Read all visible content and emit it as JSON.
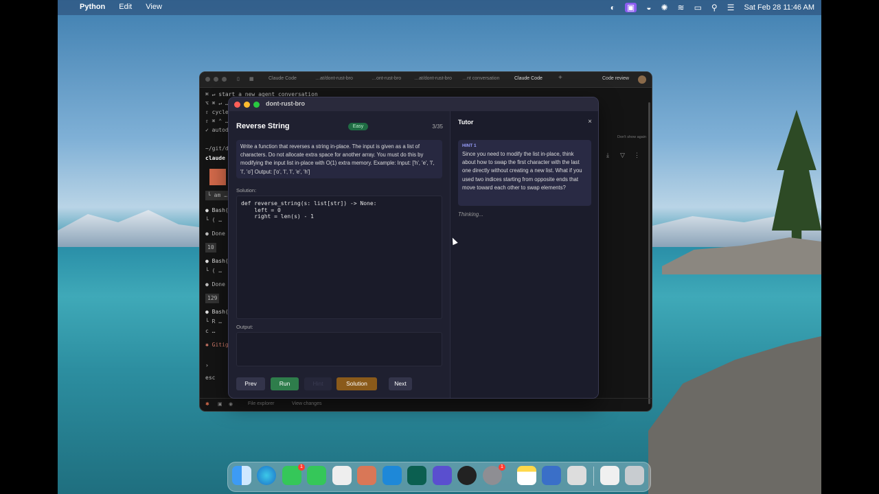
{
  "menubar": {
    "app_name": "Python",
    "items": [
      "Edit",
      "View"
    ],
    "datetime": "Sat Feb 28  11:46 AM"
  },
  "terminal": {
    "tabs": [
      "Claude Code",
      "…at/dont-rust-bro",
      "…ont-rust-bro",
      "…at/dont-rust-bro",
      "…nt conversation",
      "Claude Code"
    ],
    "code_review": "Code review",
    "lines": [
      "⌘ ↵  start a new agent conversation",
      "⌥ ⌘ ↵  …",
      "⇧  cycle p…",
      "⇧ ⌘ ⌃  …",
      "✓  autod…",
      "~/git/d…",
      "claude …",
      "└ am …",
      "● Bash(…",
      "└ ( …",
      "● Done …",
      "10",
      "● Bash(…",
      "└ ( …",
      "● Done …",
      "129",
      "● Bash(…",
      "└ R …",
      "c …",
      "✱ Gitig…",
      "›",
      "esc"
    ],
    "dont_show": "Don't show again",
    "status": {
      "file_explorer": "File explorer",
      "view_changes": "View changes"
    }
  },
  "app": {
    "window_title": "dont-rust-bro",
    "problem": {
      "title": "Reverse String",
      "difficulty": "Easy",
      "counter": "3/35",
      "description": "Write a function that reverses a string in-place. The input is given as a list of characters. Do not allocate extra space for another array. You must do this by modifying the input list in-place with O(1) extra memory. Example: Input: ['h', 'e', 'l', 'l', 'o'] Output: ['o', 'l', 'l', 'e', 'h']"
    },
    "solution_label": "Solution:",
    "code": "def reverse_string(s: list[str]) -> None:\n    left = 0\n    right = len(s) - 1",
    "output_label": "Output:",
    "buttons": {
      "prev": "Prev",
      "run": "Run",
      "hint": "Hint",
      "solution": "Solution",
      "next": "Next"
    },
    "tutor": {
      "title": "Tutor",
      "close": "×",
      "hint_label": "HINT 1",
      "hint_text": "Since you need to modify the list in-place, think about how to swap the first character with the last one directly without creating a new list. What if you used two indices starting from opposite ends that move toward each other to swap elements?",
      "thinking": "Thinking..."
    }
  },
  "dock": {
    "apps": [
      "finder-icon",
      "edge-beta-icon",
      "messages-icon",
      "phone-icon",
      "terminal-icon",
      "claude-icon",
      "vscode-icon",
      "chatgpt-icon",
      "screen-icon",
      "obs-icon",
      "settings-icon",
      "notes-icon",
      "app-icon",
      "remote-icon",
      "downloads-icon",
      "trash-icon"
    ],
    "badges": {
      "messages": "1",
      "settings": "1"
    }
  },
  "colors": {
    "run_button": "#2e7d4b",
    "solution_button": "#8a5a1a",
    "easy_badge": "#1f6b43",
    "app_bg": "#1c1d2d"
  }
}
